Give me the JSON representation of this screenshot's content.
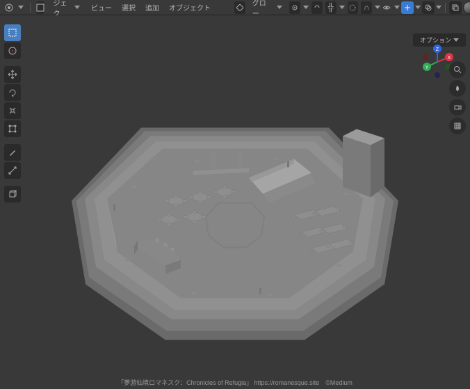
{
  "header": {
    "mode_selector": "オブジェクト…",
    "menu": {
      "view": "ビュー",
      "select": "選択",
      "add": "追加",
      "object": "オブジェクト"
    },
    "center_dropdown": "グロー…",
    "options_label": "オプション"
  },
  "tools": {
    "cursor": "cursor",
    "select_box": "select-box",
    "move": "move",
    "rotate": "rotate",
    "scale": "scale",
    "transform": "transform",
    "annotate": "annotate",
    "measure": "measure",
    "add_cube": "add-cube"
  },
  "right_tools": {
    "zoom": "zoom",
    "move_view": "move-view",
    "camera": "camera",
    "perspective": "perspective"
  },
  "gizmo": {
    "axes": [
      "X",
      "Y",
      "Z"
    ]
  },
  "footer": "「夢游仙境ロマネスク：Chronicles of Refugia」 https://romanesque.site　©Medium"
}
